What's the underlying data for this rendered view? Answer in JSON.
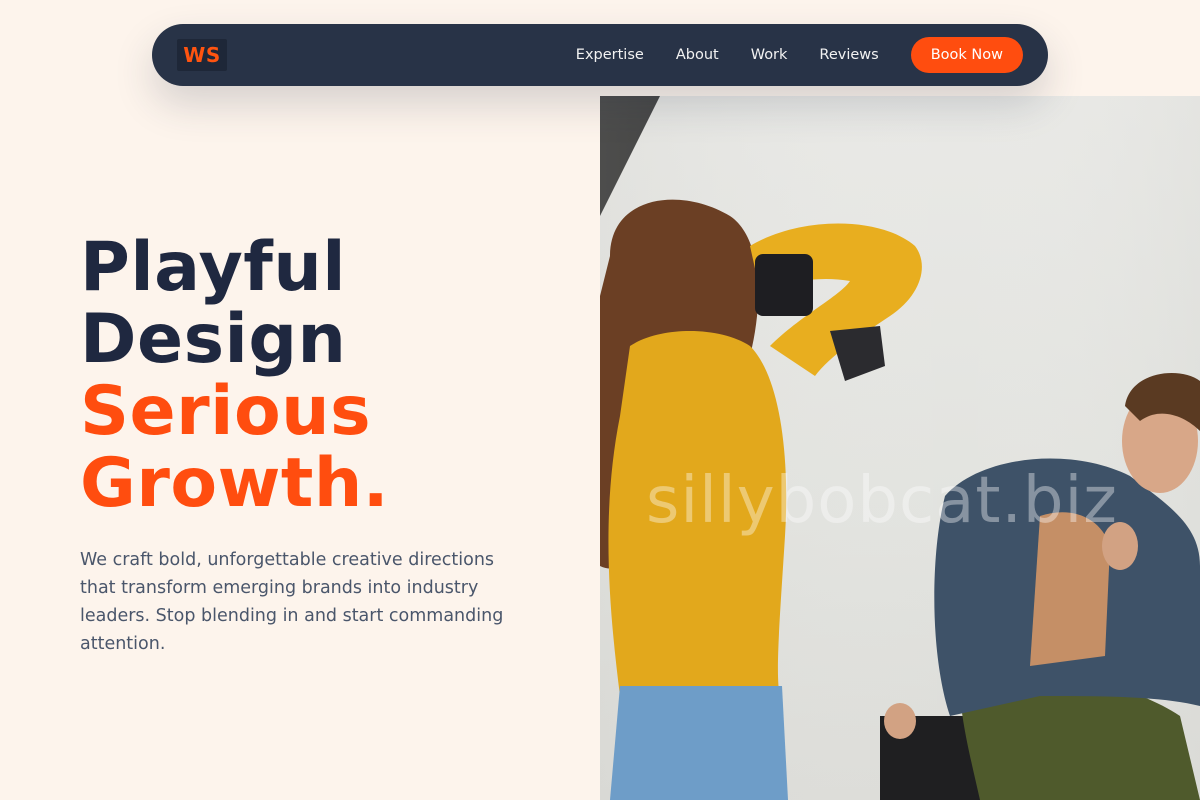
{
  "nav": {
    "logo": "WS",
    "links": [
      "Expertise",
      "About",
      "Work",
      "Reviews"
    ],
    "cta": "Book Now"
  },
  "hero": {
    "title_line1": "Playful",
    "title_line2": "Design",
    "title_line3": "Serious",
    "title_line4": "Growth.",
    "description": "We craft bold, unforgettable creative directions that transform emerging brands into industry leaders. Stop blending in and start commanding attention."
  },
  "photo": {
    "watermark": "sillybobcat.biz"
  },
  "colors": {
    "background": "#fdf4ec",
    "nav": "#283347",
    "accent": "#ff4d0f",
    "heading": "#1f2840",
    "body_text": "#4a566b"
  }
}
